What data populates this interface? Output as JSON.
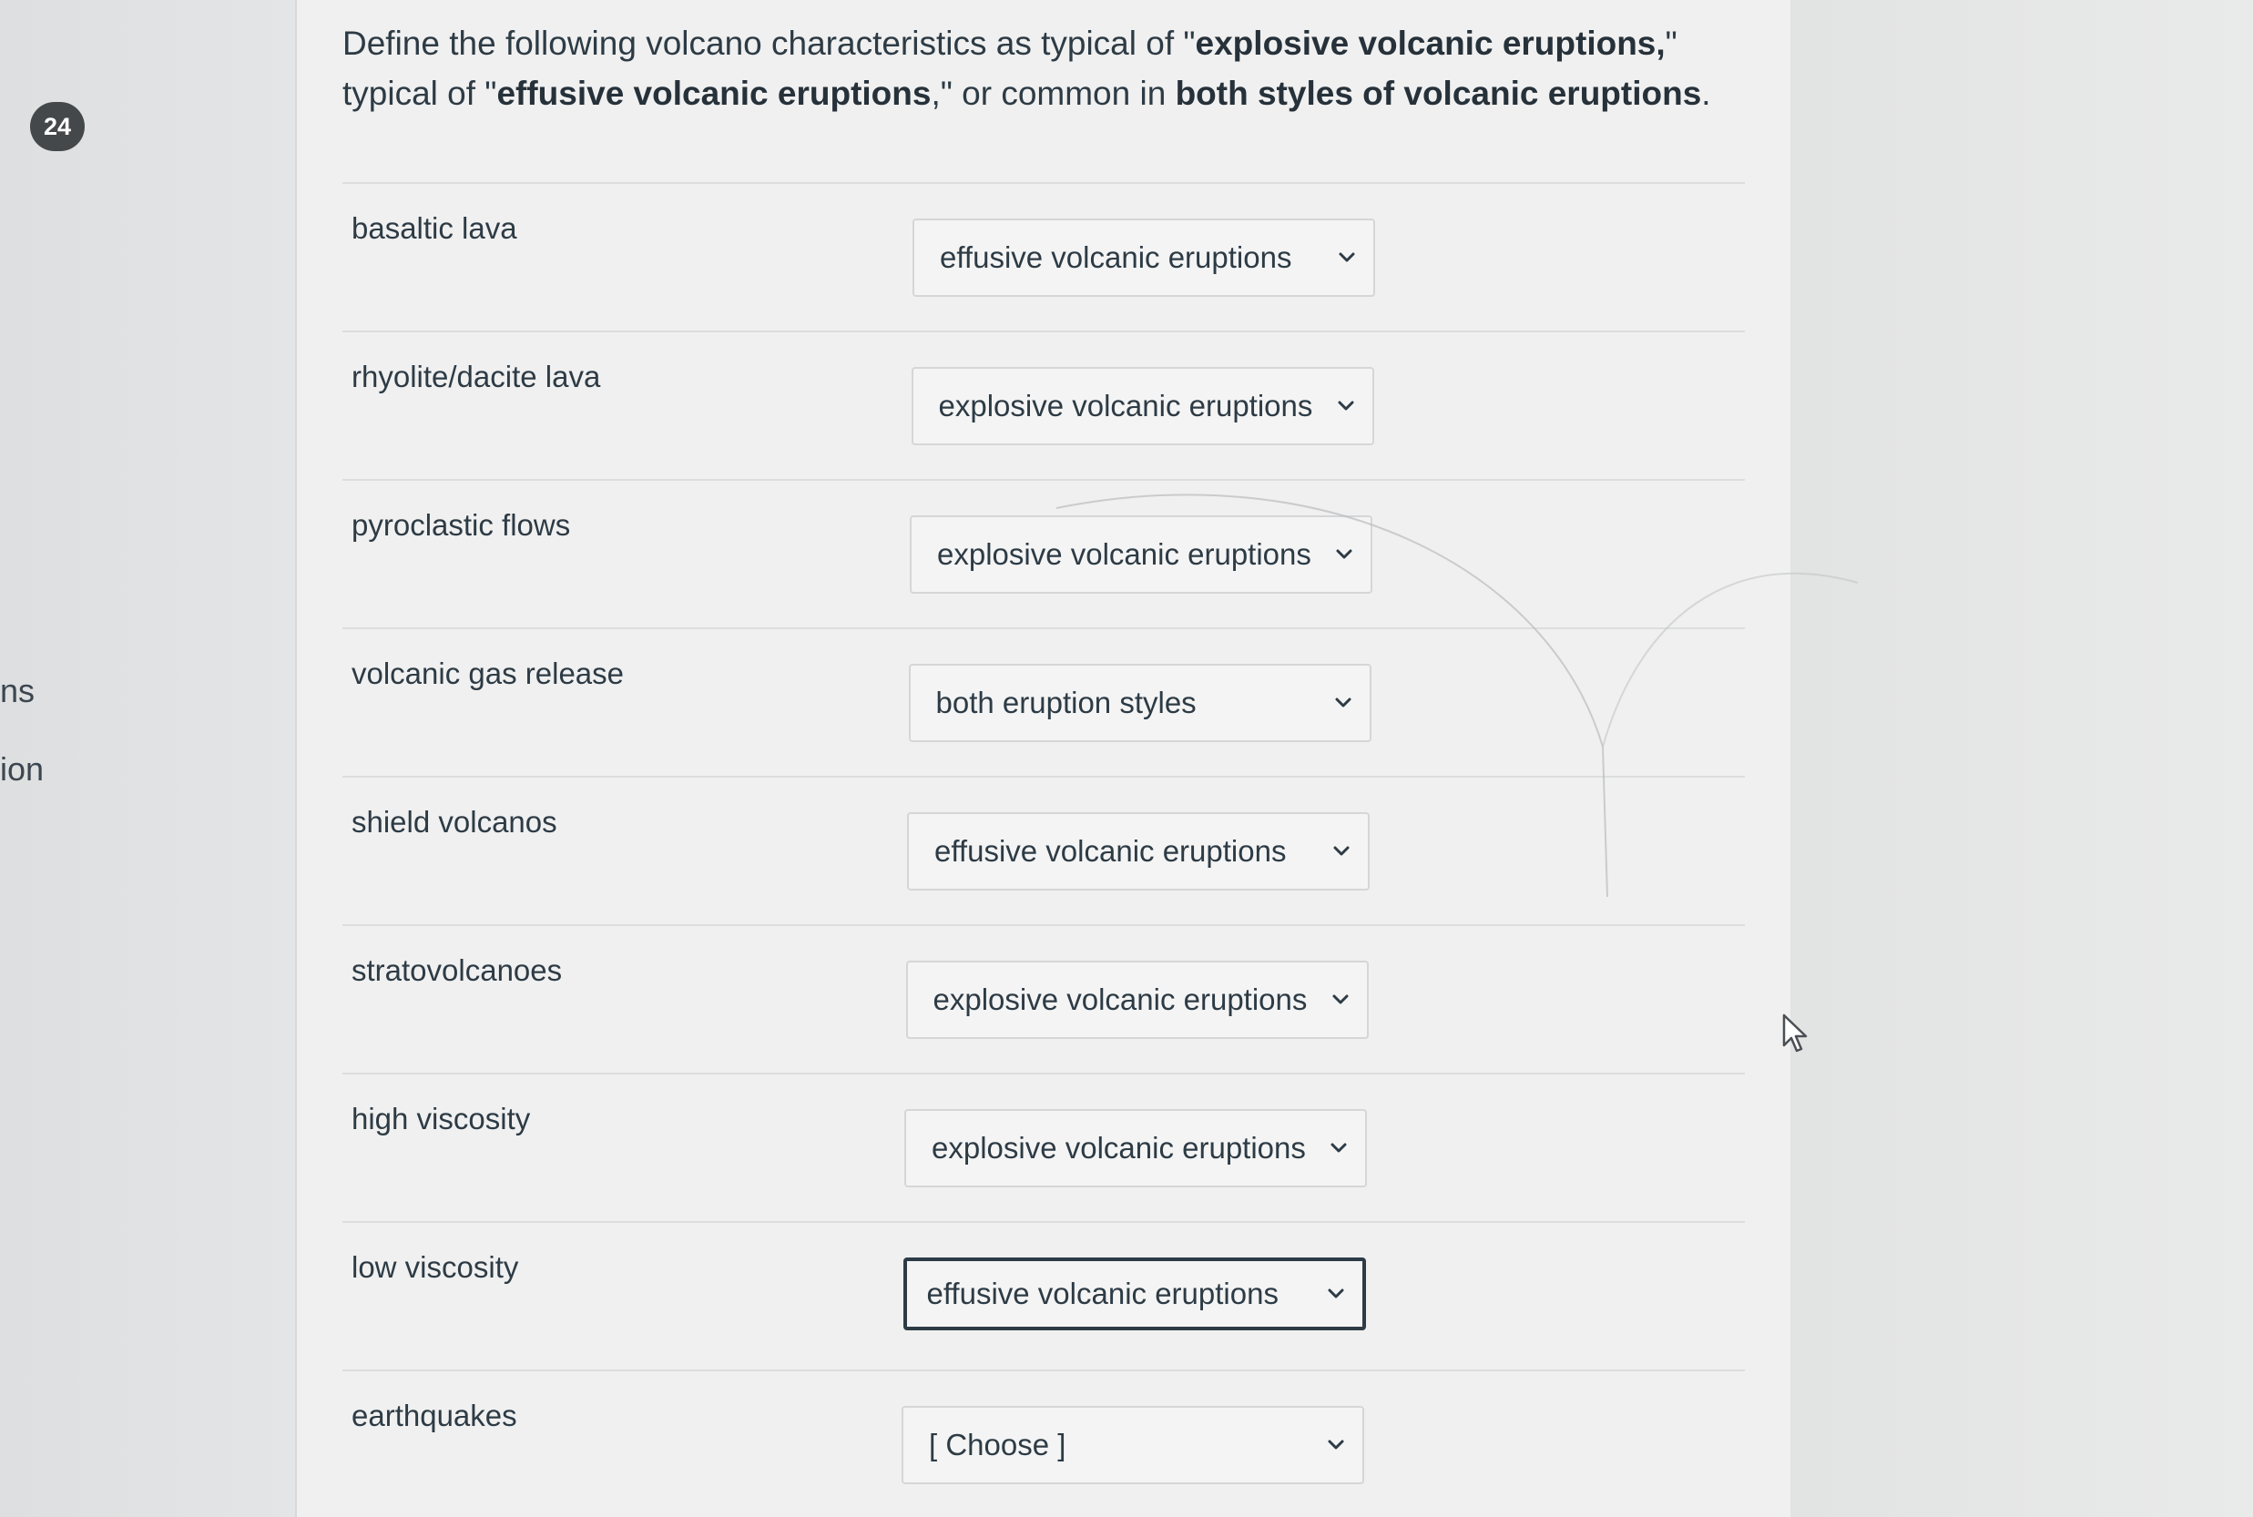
{
  "question_number": "24",
  "rail_labels": [
    "ns",
    "ion"
  ],
  "question": {
    "p1": "Define the following volcano characteristics as typical of \"",
    "b1": "explosive volcanic eruptions,",
    "p2": "\" typical of \"",
    "b2": "effusive volcanic eruptions",
    "p3": ",\" or common in ",
    "b3": "both styles of volcanic eruptions",
    "p4": "."
  },
  "rows": [
    {
      "label": "basaltic lava",
      "selected": "effusive volcanic eruptions"
    },
    {
      "label": "rhyolite/dacite lava",
      "selected": "explosive volcanic eruptions"
    },
    {
      "label": "pyroclastic flows",
      "selected": "explosive volcanic eruptions"
    },
    {
      "label": "volcanic gas release",
      "selected": "both eruption styles"
    },
    {
      "label": "shield volcanos",
      "selected": "effusive volcanic eruptions"
    },
    {
      "label": "stratovolcanoes",
      "selected": "explosive volcanic eruptions"
    },
    {
      "label": "high viscosity",
      "selected": "explosive volcanic eruptions"
    },
    {
      "label": "low viscosity",
      "selected": "effusive volcanic eruptions"
    },
    {
      "label": "earthquakes",
      "selected": "[ Choose ]"
    }
  ],
  "icons": {
    "dropdown": "chevron-down-icon",
    "cursor": "mouse-pointer-icon"
  },
  "colors": {
    "text": "#2d3b45",
    "badge": "#44484b",
    "focus_border": "#2d3b45"
  }
}
